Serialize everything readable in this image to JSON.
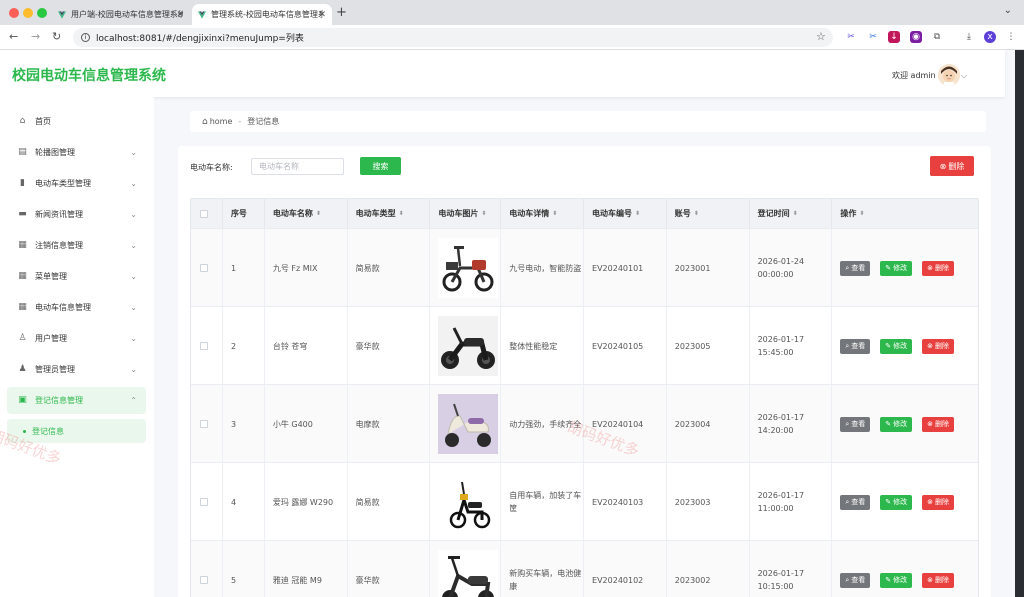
{
  "browser": {
    "tabs": [
      {
        "title": "用户端-校园电动车信息管理系统",
        "active": false
      },
      {
        "title": "管理系统-校园电动车信息管理系统",
        "active": true
      }
    ],
    "url": "localhost:8081/#/dengjixinxi?menuJump=列表"
  },
  "header": {
    "title": "校园电动车信息管理系统",
    "welcome": "欢迎 admin"
  },
  "sidebar": {
    "items": [
      {
        "label": "首页",
        "icon": "home-icon",
        "expandable": false
      },
      {
        "label": "轮播图管理",
        "icon": "image-icon",
        "expandable": true
      },
      {
        "label": "电动车类型管理",
        "icon": "book-icon",
        "expandable": true
      },
      {
        "label": "新闻资讯管理",
        "icon": "news-icon",
        "expandable": true
      },
      {
        "label": "注销信息管理",
        "icon": "grid-icon",
        "expandable": true
      },
      {
        "label": "菜单管理",
        "icon": "grid-icon",
        "expandable": true
      },
      {
        "label": "电动车信息管理",
        "icon": "grid-icon",
        "expandable": true
      },
      {
        "label": "用户管理",
        "icon": "user-icon",
        "expandable": true
      },
      {
        "label": "管理员管理",
        "icon": "person-icon",
        "expandable": true
      },
      {
        "label": "登记信息管理",
        "icon": "chip-icon",
        "expandable": true,
        "active": true
      }
    ],
    "sub_item": "登记信息"
  },
  "breadcrumb": {
    "home": "home",
    "separator": "-",
    "current": "登记信息"
  },
  "search": {
    "label": "电动车名称:",
    "placeholder": "电动车名称",
    "button": "搜索",
    "delete_button": "删除"
  },
  "table": {
    "columns": [
      "序号",
      "电动车名称",
      "电动车类型",
      "电动车图片",
      "电动车详情",
      "电动车编号",
      "账号",
      "登记时间",
      "操作"
    ],
    "ops": {
      "view": "查看",
      "edit": "修改",
      "delete": "删除"
    },
    "rows": [
      {
        "no": "1",
        "name": "九号 Fz MIX",
        "type": "简易款",
        "detail": "九号电动，智能防盗",
        "code": "EV20240101",
        "account": "2023001",
        "time": "2026-01-24 00:00:00"
      },
      {
        "no": "2",
        "name": "台铃 苍穹",
        "type": "豪华款",
        "detail": "整体性能稳定",
        "code": "EV20240105",
        "account": "2023005",
        "time": "2026-01-17 15:45:00"
      },
      {
        "no": "3",
        "name": "小牛 G400",
        "type": "电摩款",
        "detail": "动力强劲，手续齐全",
        "code": "EV20240104",
        "account": "2023004",
        "time": "2026-01-17 14:20:00"
      },
      {
        "no": "4",
        "name": "爱玛 露娜 W290",
        "type": "简易款",
        "detail": "自用车辆，加装了车筐",
        "code": "EV20240103",
        "account": "2023003",
        "time": "2026-01-17 11:00:00"
      },
      {
        "no": "5",
        "name": "雅迪 冠能 M9",
        "type": "豪华款",
        "detail": "新购买车辆，电池健康",
        "code": "EV20240102",
        "account": "2023002",
        "time": "2026-01-17 10:15:00"
      }
    ]
  },
  "watermark": "胡码好优多",
  "colors": {
    "primary": "#2db84d",
    "danger": "#e8403e",
    "info": "#73767a"
  }
}
